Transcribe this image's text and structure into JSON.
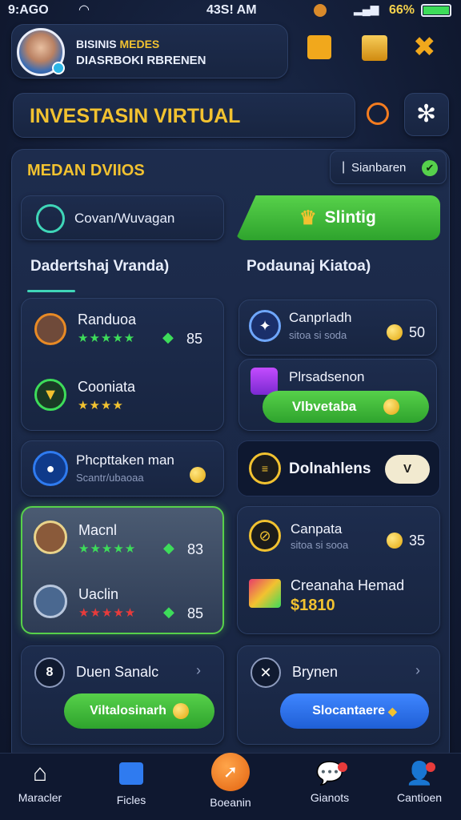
{
  "status_bar": {
    "carrier": "9:AGO",
    "time": "43S! AM",
    "battery": "66%"
  },
  "header": {
    "line1": "BISINIS",
    "line1_accent": "MEDES",
    "line2": "DIASRBOKI RBRENEN"
  },
  "title_bar": {
    "title": "INVESTASIN VIRTUAL"
  },
  "section": {
    "title": "MEDAN DVIIOS",
    "badge": "Sianbaren"
  },
  "search": {
    "label": "Covan/Wuvagan"
  },
  "cta": {
    "label": "Slintig"
  },
  "columns": {
    "left": "Dadertshaj Vranda)",
    "right": "Podaunaj Kiatoa)"
  },
  "left_items": [
    {
      "name": "Randuoa",
      "stars": "★★★★★",
      "value": "85"
    },
    {
      "name": "Cooniata",
      "stars": "★★★★"
    },
    {
      "name": "Phcpttaken man",
      "sub": "Scantr/ubaoaa"
    },
    {
      "name": "Macnl",
      "stars": "★★★★★",
      "value": "83"
    },
    {
      "name": "Uaclin",
      "stars": "★★★★★",
      "value": "85"
    },
    {
      "name": "Duen Sanalc",
      "button": "Viltalosinarh"
    }
  ],
  "right_items": [
    {
      "name": "Canprladh",
      "sub": "sitoa si soda",
      "value": "50"
    },
    {
      "name": "Plrsadsenon",
      "button": "Vlbvetaba"
    },
    {
      "name": "Dolnahlens",
      "toggle": "V"
    },
    {
      "name": "Canpata",
      "sub": "sitoa si sooa",
      "value": "35"
    },
    {
      "name": "Creanaha Hemad",
      "price": "$1810"
    },
    {
      "name": "Brynen",
      "button": "Slocantaere"
    }
  ],
  "nav": [
    {
      "label": "Maracler"
    },
    {
      "label": "Ficles"
    },
    {
      "label": "Boeanin"
    },
    {
      "label": "Gianots"
    },
    {
      "label": "Cantioen"
    }
  ],
  "colors": {
    "accent_gold": "#f2c230",
    "green": "#3ddc5a",
    "orange": "#f57c1f",
    "blue": "#2f73f0"
  }
}
